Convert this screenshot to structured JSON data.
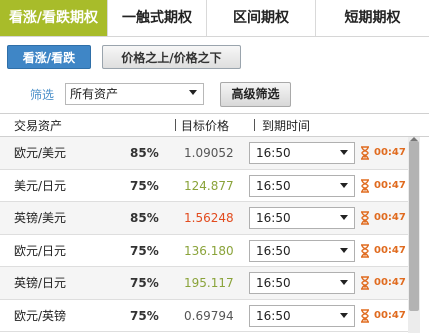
{
  "tabs": [
    {
      "label": "看涨/看跌期权",
      "active": true
    },
    {
      "label": "一触式期权",
      "active": false
    },
    {
      "label": "区间期权",
      "active": false
    },
    {
      "label": "短期期权",
      "active": false
    }
  ],
  "subtabs": [
    {
      "label": "看涨/看跌",
      "active": true
    },
    {
      "label": "价格之上/价格之下",
      "active": false
    }
  ],
  "filter": {
    "label": "筛选",
    "selected": "所有资产",
    "advanced_button": "高级筛选"
  },
  "table": {
    "headers": {
      "asset": "交易资产",
      "target": "目标价格",
      "expiry": "到期时间"
    },
    "rows": [
      {
        "asset": "欧元/美元",
        "pct": "85%",
        "price": "1.09052",
        "price_color": "#555555",
        "time": "16:50",
        "countdown": "00:47"
      },
      {
        "asset": "美元/日元",
        "pct": "75%",
        "price": "124.877",
        "price_color": "#8aa33a",
        "time": "16:50",
        "countdown": "00:47"
      },
      {
        "asset": "英镑/美元",
        "pct": "85%",
        "price": "1.56248",
        "price_color": "#e24b1e",
        "time": "16:50",
        "countdown": "00:47"
      },
      {
        "asset": "欧元/日元",
        "pct": "75%",
        "price": "136.180",
        "price_color": "#8aa33a",
        "time": "16:50",
        "countdown": "00:47"
      },
      {
        "asset": "英镑/日元",
        "pct": "75%",
        "price": "195.117",
        "price_color": "#8aa33a",
        "time": "16:50",
        "countdown": "00:47"
      },
      {
        "asset": "欧元/英镑",
        "pct": "75%",
        "price": "0.69794",
        "price_color": "#555555",
        "time": "16:50",
        "countdown": "00:47"
      }
    ]
  },
  "colors": {
    "accent_tab": "#a8bc2a",
    "subtab_active": "#3f86c6",
    "countdown": "#e06b1f"
  },
  "icons": {
    "expiry_icon": "hourglass-icon",
    "dropdown": "chevron-down-icon"
  }
}
